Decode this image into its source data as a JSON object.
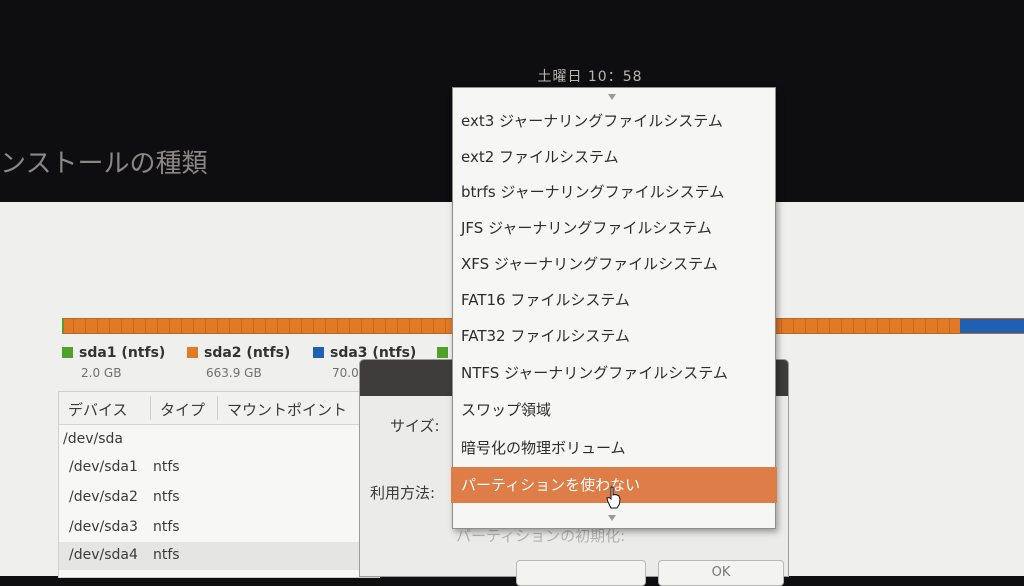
{
  "topbar": {
    "clock": "土曜日 10：58"
  },
  "installer": {
    "title": "ンストールの種類"
  },
  "disk": {
    "legend": [
      {
        "name": "sda1 (ntfs)",
        "size": "2.0 GB",
        "color": "#4ea12a"
      },
      {
        "name": "sda2 (ntfs)",
        "size": "663.9 GB",
        "color": "#e07a27"
      },
      {
        "name": "sda3 (ntfs)",
        "size": "70.0",
        "color": "#1f5fb4"
      }
    ],
    "extra_legend_color": "#4ea12a"
  },
  "table": {
    "headers": [
      "デバイス",
      "タイプ",
      "マウントポイント"
    ],
    "rows": [
      {
        "device": "/dev/sda",
        "type": ""
      },
      {
        "device": "/dev/sda1",
        "type": "ntfs"
      },
      {
        "device": "/dev/sda2",
        "type": "ntfs"
      },
      {
        "device": "/dev/sda3",
        "type": "ntfs"
      },
      {
        "device": "/dev/sda4",
        "type": "ntfs"
      }
    ]
  },
  "dialog": {
    "size_label": "サイズ:",
    "use_as_label": "利用方法:",
    "format_label": "パーティションの初期化:",
    "ok_label": "OK"
  },
  "dropdown": {
    "options": [
      "ext3 ジャーナリングファイルシステム",
      "ext2 ファイルシステム",
      "btrfs ジャーナリングファイルシステム",
      "JFS ジャーナリングファイルシステム",
      "XFS ジャーナリングファイルシステム",
      "FAT16 ファイルシステム",
      "FAT32 ファイルシステム",
      "NTFS ジャーナリングファイルシステム",
      "スワップ領域",
      "暗号化の物理ボリューム",
      "パーティションを使わない"
    ],
    "selected_index": 10,
    "selected_color": "#de7d47"
  }
}
